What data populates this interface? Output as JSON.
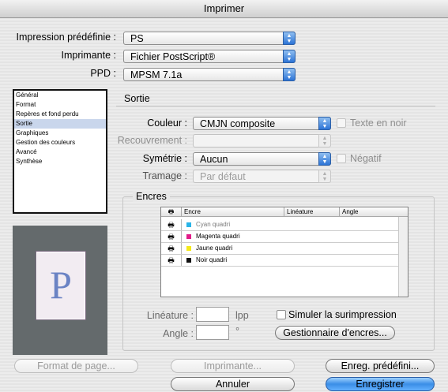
{
  "window": {
    "title": "Imprimer"
  },
  "top": {
    "preset_label": "Impression prédéfinie :",
    "preset_value": "PS",
    "printer_label": "Imprimante :",
    "printer_value": "Fichier PostScript®",
    "ppd_label": "PPD :",
    "ppd_value": "MPSM 7.1a"
  },
  "sidebar": {
    "items": [
      {
        "label": "Général"
      },
      {
        "label": "Format"
      },
      {
        "label": "Repères et fond perdu"
      },
      {
        "label": "Sortie",
        "selected": true
      },
      {
        "label": "Graphiques"
      },
      {
        "label": "Gestion des couleurs"
      },
      {
        "label": "Avancé"
      },
      {
        "label": "Synthèse"
      }
    ]
  },
  "preview": {
    "letter": "P"
  },
  "output": {
    "section_title": "Sortie",
    "color_label": "Couleur :",
    "color_value": "CMJN composite",
    "text_black_label": "Texte en noir",
    "trapping_label": "Recouvrement :",
    "trapping_value": "",
    "flip_label": "Symétrie :",
    "flip_value": "Aucun",
    "negative_label": "Négatif",
    "screening_label": "Tramage :",
    "screening_value": "Par défaut"
  },
  "inks": {
    "section_title": "Encres",
    "columns": [
      "Encre",
      "Linéature",
      "Angle"
    ],
    "rows": [
      {
        "name": "Cyan quadri",
        "color": "#29b4e8"
      },
      {
        "name": "Magenta quadri",
        "color": "#e21c8a"
      },
      {
        "name": "Jaune quadri",
        "color": "#f4e91a"
      },
      {
        "name": "Noir quadri",
        "color": "#111111"
      }
    ],
    "frequency_label": "Linéature :",
    "frequency_unit": "lpp",
    "angle_label": "Angle :",
    "angle_unit": "°",
    "simulate_overprint_label": "Simuler la surimpression",
    "ink_manager_button": "Gestionnaire d'encres..."
  },
  "footer": {
    "page_setup": "Format de page...",
    "printer": "Imprimante...",
    "save_preset": "Enreg. prédéfini...",
    "cancel": "Annuler",
    "save": "Enregistrer"
  },
  "colors": {
    "accent": "#3a8ee6",
    "selection": "#c9d6ec",
    "preview_bg": "#646a6c"
  }
}
